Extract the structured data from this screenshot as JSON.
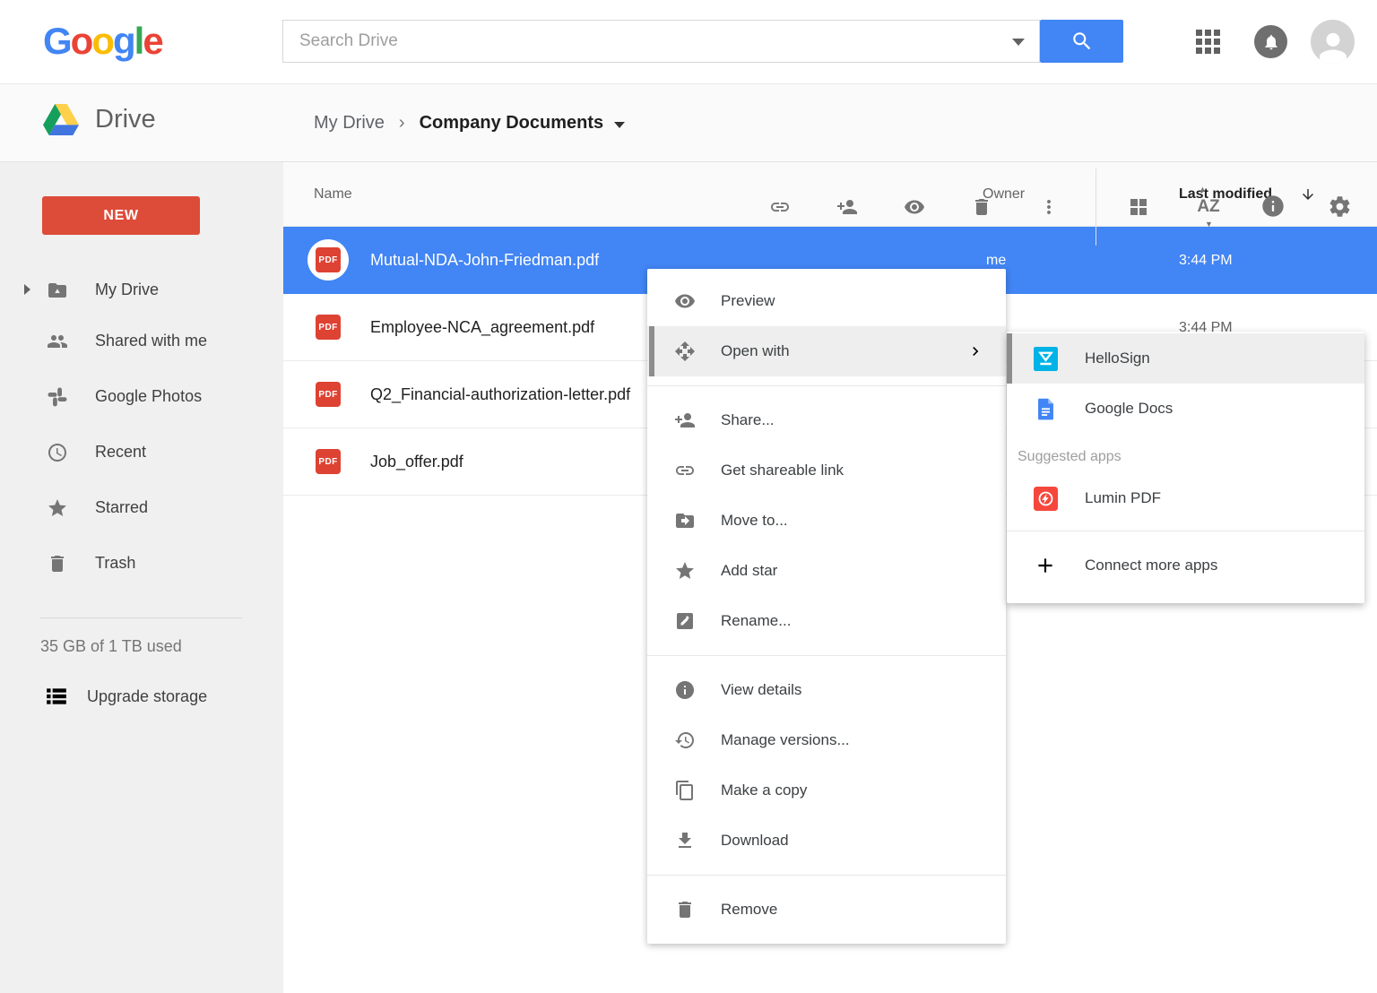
{
  "topbar": {
    "logo": {
      "letters": [
        {
          "ch": "G",
          "color": "#4285F4"
        },
        {
          "ch": "o",
          "color": "#EA4335"
        },
        {
          "ch": "o",
          "color": "#FBBC05"
        },
        {
          "ch": "g",
          "color": "#4285F4"
        },
        {
          "ch": "l",
          "color": "#34A853"
        },
        {
          "ch": "e",
          "color": "#EA4335"
        }
      ]
    },
    "search": {
      "placeholder": "Search Drive"
    }
  },
  "drive_header": {
    "app_name": "Drive",
    "breadcrumb": {
      "parent": "My Drive",
      "separator": "›",
      "current": "Company Documents"
    },
    "sort_icon_text": "AZ"
  },
  "sidebar": {
    "new_button_label": "NEW",
    "items": [
      {
        "icon": "folder-drive",
        "label": "My Drive",
        "expandable": true
      },
      {
        "icon": "people",
        "label": "Shared with me"
      },
      {
        "icon": "photos-pinwheel",
        "label": "Google Photos"
      },
      {
        "icon": "clock",
        "label": "Recent"
      },
      {
        "icon": "star",
        "label": "Starred"
      },
      {
        "icon": "trash",
        "label": "Trash"
      }
    ],
    "storage_text": "35 GB of 1 TB used",
    "upgrade_label": "Upgrade storage"
  },
  "file_list": {
    "columns": {
      "name": "Name",
      "owner": "Owner",
      "last_modified": "Last modified"
    },
    "sort": {
      "column": "Last modified",
      "direction": "desc"
    },
    "pdf_badge": "PDF",
    "rows": [
      {
        "name": "Mutual-NDA-John-Friedman.pdf",
        "type": "pdf",
        "owner": "me",
        "modified": "3:44 PM",
        "selected": true
      },
      {
        "name": "Employee-NCA_agreement.pdf",
        "type": "pdf",
        "modified": "3:44 PM"
      },
      {
        "name": "Q2_Financial-authorization-letter.pdf",
        "type": "pdf"
      },
      {
        "name": "Job_offer.pdf",
        "type": "pdf"
      }
    ]
  },
  "context_menu": {
    "groups": [
      {
        "items": [
          {
            "icon": "eye",
            "label": "Preview"
          },
          {
            "icon": "open-with-arrows",
            "label": "Open with",
            "has_submenu": true,
            "highlighted": true
          }
        ]
      },
      {
        "items": [
          {
            "icon": "person-add",
            "label": "Share..."
          },
          {
            "icon": "link",
            "label": "Get shareable link"
          },
          {
            "icon": "folder-move",
            "label": "Move to..."
          },
          {
            "icon": "star",
            "label": "Add star"
          },
          {
            "icon": "pencil-square",
            "label": "Rename..."
          }
        ]
      },
      {
        "items": [
          {
            "icon": "info-circle",
            "label": "View details"
          },
          {
            "icon": "history-clock",
            "label": "Manage versions..."
          },
          {
            "icon": "copy",
            "label": "Make a copy"
          },
          {
            "icon": "download",
            "label": "Download"
          }
        ]
      },
      {
        "items": [
          {
            "icon": "trash",
            "label": "Remove"
          }
        ]
      }
    ]
  },
  "open_with_submenu": {
    "items": [
      {
        "icon": "hellosign",
        "label": "HelloSign",
        "highlighted": true
      },
      {
        "icon": "google-docs",
        "label": "Google Docs"
      }
    ],
    "section_label": "Suggested apps",
    "suggested": [
      {
        "icon": "lumin-pdf",
        "label": "Lumin PDF"
      }
    ],
    "more_label": "Connect more apps"
  },
  "colors": {
    "selection_blue": "#4285F4",
    "search_button_blue": "#4285F4",
    "new_button_red": "#DD4B39",
    "pdf_icon_red": "#DD4232",
    "hellosign_cyan": "#00B3E6",
    "lumin_red": "#F5473C",
    "docs_blue": "#4285F4",
    "sidebar_bg": "#F0F0F0",
    "menu_highlight": "#EEEEEE"
  }
}
